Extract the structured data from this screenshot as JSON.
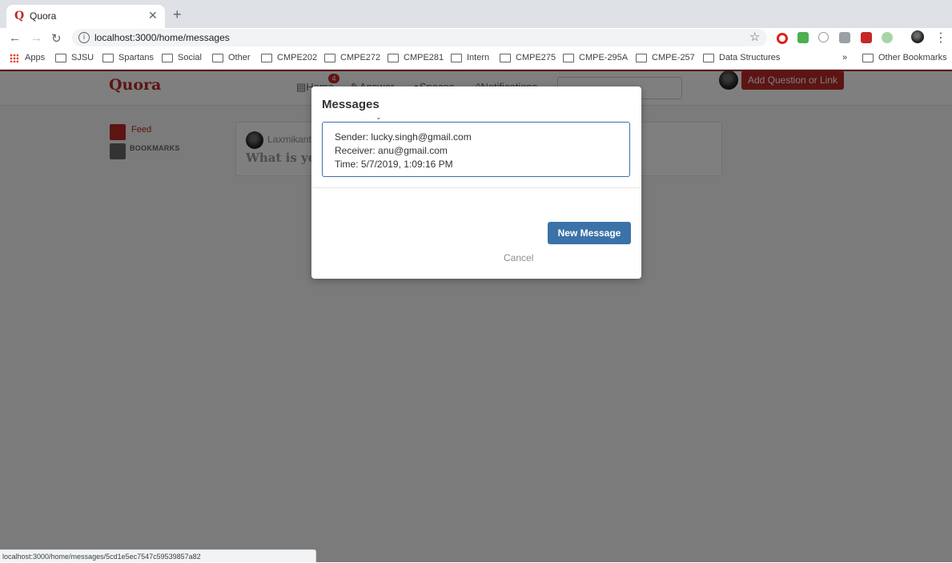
{
  "browser": {
    "tab_title": "Quora",
    "tab_favicon": "Q",
    "url": "localhost:3000/home/messages",
    "status_url": "localhost:3000/home/messages/5cd1e5ec7547c59539857a82",
    "bookmarks": [
      "Apps",
      "SJSU",
      "Spartans",
      "Social",
      "Other",
      "CMPE202",
      "CMPE272",
      "CMPE281",
      "Intern",
      "CMPE275",
      "CMPE-295A",
      "CMPE-257",
      "Data Structures"
    ],
    "overflow": "»",
    "other_bookmarks": "Other Bookmarks"
  },
  "site": {
    "logo": "Quora",
    "nav": {
      "home": "Home",
      "answer": "Answer",
      "spaces": "Spaces",
      "notifications": "Notifications"
    },
    "home_badge": "4",
    "add_question": "Add Question or Link",
    "sidebar": {
      "feed": "Feed",
      "bookmarks": "BOOKMARKS"
    },
    "card": {
      "author": "Laxmikant",
      "question": "What is yo"
    }
  },
  "modal": {
    "title": "Messages",
    "message": {
      "sender": "Sender: lucky.singh@gmail.com",
      "receiver": "Receiver: anu@gmail.com",
      "time": "Time: 5/7/2019, 1:09:16 PM"
    },
    "new_message": "New Message",
    "cancel": "Cancel"
  },
  "colors": {
    "brand": "#b92b27",
    "primary_button": "#3b72a8"
  }
}
